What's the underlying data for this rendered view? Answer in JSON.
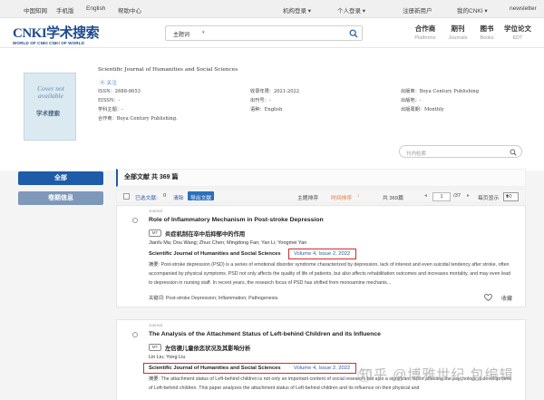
{
  "topbar": {
    "home": "中国知网",
    "mobile": "手机版",
    "english": "English",
    "help": "帮助中心",
    "org_login": "机构登录",
    "personal": "个人登录",
    "register": "注册新用户",
    "cnki_link": "我的CNKI",
    "newsletter": "newsletter"
  },
  "header": {
    "logo_main": "CNKI学术搜索",
    "logo_sub": "WORLD OF CNKI CNKI OF WORLD",
    "search_select": "主题词",
    "nav": [
      {
        "cn": "合作商",
        "en": "Platforms"
      },
      {
        "cn": "期刊",
        "en": "Journals"
      },
      {
        "cn": "图书",
        "en": "Books"
      },
      {
        "cn": "学位论文",
        "en": "EDT"
      }
    ]
  },
  "journal": {
    "cover_text": "Cover not available",
    "cover_brand": "学术搜索",
    "title": "Scientific Journal of Humanities and Social Sciences",
    "follow": "关注",
    "issn": "ISSN：2688-8653",
    "eissn": "EISSN：-",
    "subject": "学科主题：-",
    "partner": "合作商：Boya Century Publishing.",
    "years": "收录年限：2021-2022",
    "pubno": "出刊号：-",
    "language": "语种：English",
    "publisher": "出版商：Boya Century Publishing",
    "place": "出版地：-",
    "cycle": "出版周期：Monthly"
  },
  "sidebar": {
    "all": "全部",
    "issue": "卷期信息"
  },
  "inner_search": {
    "placeholder": "刊内检索"
  },
  "results": {
    "count_text": "全部文献 共 369 篇",
    "selected": "已选文献:",
    "selected_count": "0",
    "clear": "清除",
    "export": "导出文献",
    "sort_subject": "主题排序",
    "sort_time": "时间排序",
    "total": "共 369篇",
    "page": "1",
    "pages": "/37",
    "per_page_label": "每页显示",
    "per_page": "10"
  },
  "articles": [
    {
      "kind": "Journal",
      "title": "Role of Inflammatory Mechanism in Post-stroke Depression",
      "badge": "MT",
      "title_cn": "炎症机制在卒中后抑郁中的作用",
      "authors": "Jianfu Ma; Dou Wang; Zhuo Chen; Mingdong Fan; Yan Li; Yongmei Yan",
      "source": "Scientific Journal of Humanities and Social Sciences",
      "issue": "Volume 4, Issue 2, 2022",
      "abstract": "摘要: Post-stroke depression (PSD) is a series of emotional disorder syndrome characterized by depression, lack of interest and even suicidal tendency after stroke, often accompanied by physical symptoms. PSD not only affects the quality of life of patients, but also affects rehabilitation outcomes and increases mortality, and may even lead to depression in nursing staff. In recent years, the research focus of PSD has shifted from monoamine mechanis...",
      "keywords": "关键词: Post-stroke Depression; Inflammation; Pathogenesis.",
      "fav": "收藏"
    },
    {
      "kind": "Journal",
      "title": "The Analysis of the Attachment Status of Left-behind Children and its Influence",
      "badge": "MT",
      "title_cn": "左信德儿童依恋状况及其影响分析",
      "authors": "Lin Liu; Yong Liu",
      "source": "Scientific Journal of Humanities and Social Sciences",
      "issue": "Volume 4, Issue 2, 2022",
      "abstract": "摘要: The attachment status of Left-behind children is not only an important content of social research, but also a significant factor affecting the psychological development of Left-behind children. This paper analyzes the attachment status of Left-behind children and its influence on their physical and"
    }
  ],
  "watermark": "知乎 @博雅世纪 包编辑"
}
